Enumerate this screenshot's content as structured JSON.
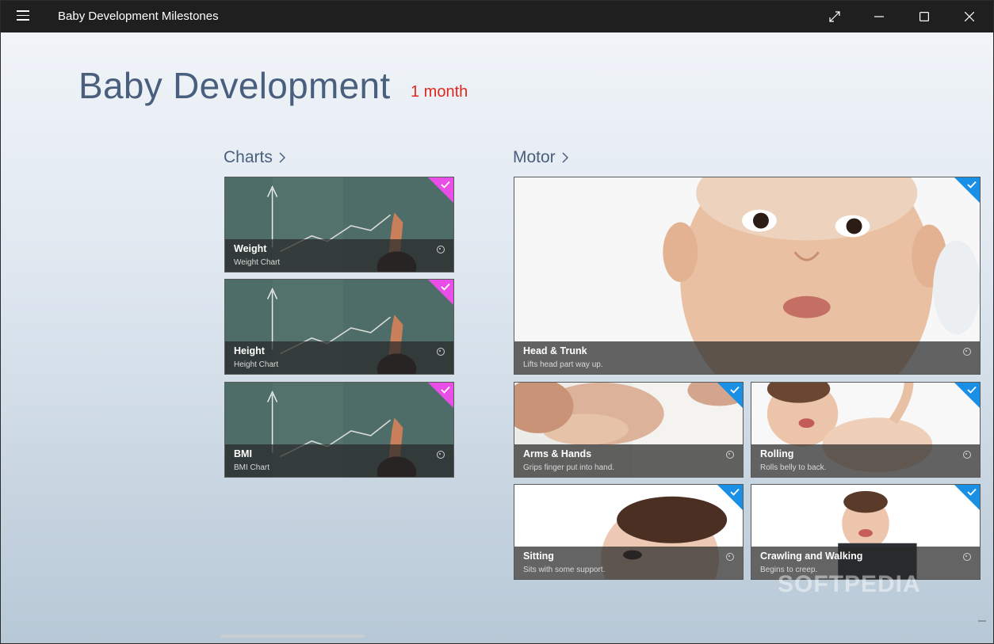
{
  "titlebar": {
    "app_title": "Baby Development Milestones",
    "icons": [
      "hamburger-menu-icon",
      "fullscreen-icon",
      "minimize-icon",
      "maximize-icon",
      "close-icon"
    ]
  },
  "header": {
    "title": "Baby Development",
    "age": "1 month"
  },
  "sections": {
    "charts": {
      "label": "Charts"
    },
    "motor": {
      "label": "Motor"
    }
  },
  "charts": [
    {
      "title": "Weight",
      "subtitle": "Weight Chart"
    },
    {
      "title": "Height",
      "subtitle": "Height Chart"
    },
    {
      "title": "BMI",
      "subtitle": "BMI Chart"
    }
  ],
  "motor": [
    {
      "title": "Head & Trunk",
      "subtitle": "Lifts head part way up."
    },
    {
      "title": "Arms & Hands",
      "subtitle": "Grips finger put into hand."
    },
    {
      "title": "Rolling",
      "subtitle": "Rolls belly to back."
    },
    {
      "title": "Sitting",
      "subtitle": "Sits with some support."
    },
    {
      "title": "Crawling and Walking",
      "subtitle": "Begins to creep."
    }
  ],
  "watermark": "SOFTPEDIA",
  "colors": {
    "charts_accent": "#e94fe6",
    "motor_accent": "#1a8fe6",
    "age_red": "#e0271f",
    "title_blue": "#4a5f7e"
  }
}
